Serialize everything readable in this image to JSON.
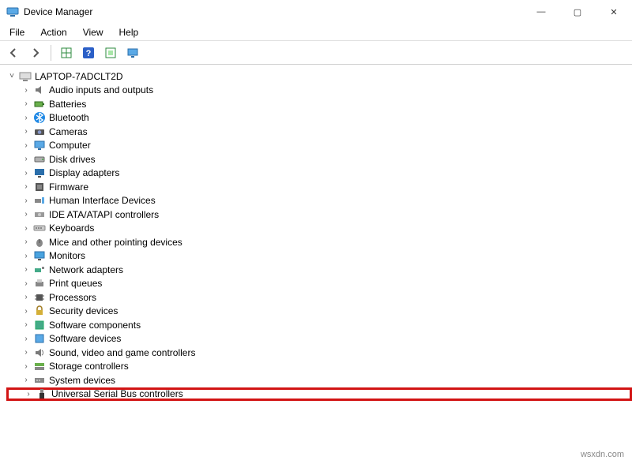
{
  "window": {
    "title": "Device Manager",
    "controls": {
      "minimize": "—",
      "maximize": "▢",
      "close": "✕"
    }
  },
  "menubar": {
    "file": "File",
    "action": "Action",
    "view": "View",
    "help": "Help"
  },
  "tree": {
    "root": {
      "name": "LAPTOP-7ADCLT2D",
      "expanded": true
    },
    "nodes": [
      {
        "id": "audio",
        "label": "Audio inputs and outputs"
      },
      {
        "id": "batteries",
        "label": "Batteries"
      },
      {
        "id": "bluetooth",
        "label": "Bluetooth"
      },
      {
        "id": "cameras",
        "label": "Cameras"
      },
      {
        "id": "computer",
        "label": "Computer"
      },
      {
        "id": "disks",
        "label": "Disk drives"
      },
      {
        "id": "display",
        "label": "Display adapters"
      },
      {
        "id": "firmware",
        "label": "Firmware"
      },
      {
        "id": "hid",
        "label": "Human Interface Devices"
      },
      {
        "id": "ide",
        "label": "IDE ATA/ATAPI controllers"
      },
      {
        "id": "keyboards",
        "label": "Keyboards"
      },
      {
        "id": "mice",
        "label": "Mice and other pointing devices"
      },
      {
        "id": "monitors",
        "label": "Monitors"
      },
      {
        "id": "network",
        "label": "Network adapters"
      },
      {
        "id": "printqueues",
        "label": "Print queues"
      },
      {
        "id": "processors",
        "label": "Processors"
      },
      {
        "id": "security",
        "label": "Security devices"
      },
      {
        "id": "softcomp",
        "label": "Software components"
      },
      {
        "id": "softdev",
        "label": "Software devices"
      },
      {
        "id": "sound",
        "label": "Sound, video and game controllers"
      },
      {
        "id": "storage",
        "label": "Storage controllers"
      },
      {
        "id": "system",
        "label": "System devices"
      },
      {
        "id": "usb",
        "label": "Universal Serial Bus controllers",
        "highlight": true
      }
    ]
  },
  "watermark": "wsxdn.com"
}
